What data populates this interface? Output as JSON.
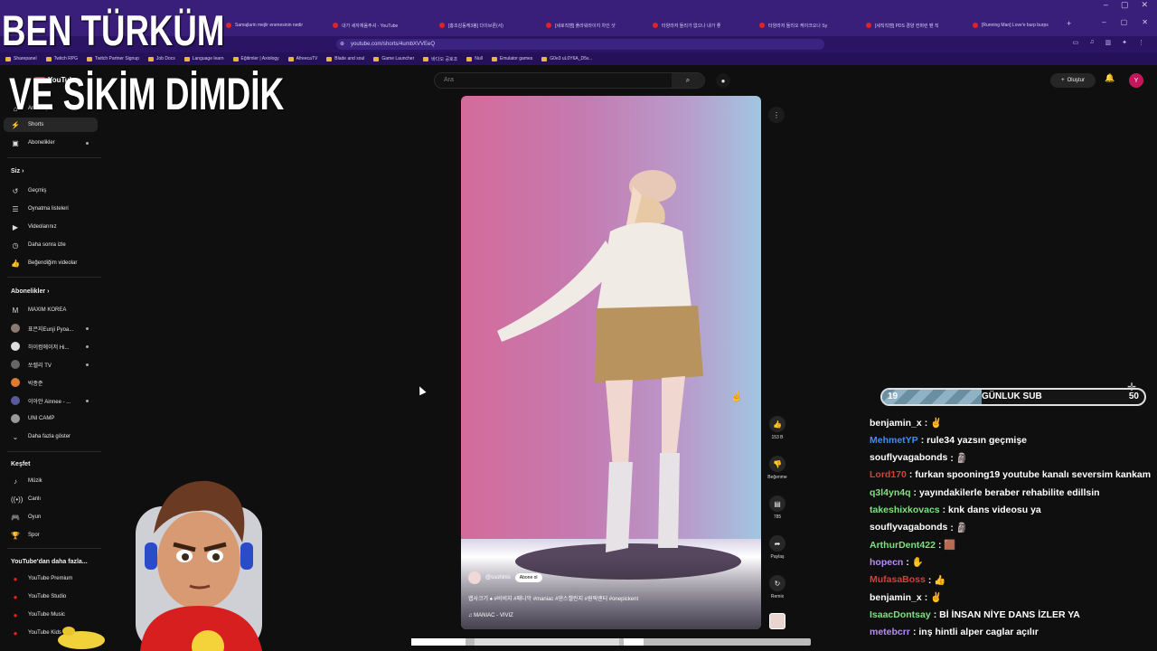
{
  "colors": {
    "browser_bg": "#3a1f7a",
    "accent_red": "#e02323",
    "bg": "#0f0f0f"
  },
  "browser": {
    "tabs": [
      "Samajlarin mejlir enenesinin nedir",
      "내가 세자재옴주셔 - YouTube",
      "[홍조감동케3봉] 다이브론(서)",
      "[세로직캠] 플라워라이지 차인 샷",
      "타양라저 돌리가 없으나 내가 좋",
      "타양라저 돌리오 케이크오나 Sy",
      "[세직직캠] PDS 경양 컨퍼런 팬 직",
      "[Running Man] Love'e burp burps"
    ],
    "url": "youtube.com/shorts/4umbXVVEeQ",
    "bookmarks": [
      "Sharepanel",
      "Twitch RPG",
      "Twitch Partner Signup",
      "Job Docs",
      "Language learn",
      "Eğitimler | Axiology",
      "AfreecaTV",
      "Blade and soul",
      "Game Launcher",
      "바다오 공호조",
      "Null",
      "Emulator games",
      "G0e3 uL0Y6A_D5v..."
    ]
  },
  "header": {
    "logo": "YouTube",
    "search_placeholder": "Ara",
    "create_label": "Oluştur",
    "avatar_letter": "Y"
  },
  "sidebar": {
    "home": "Ana Sayfa",
    "shorts": "Shorts",
    "subscriptions": "Abonelikler",
    "you_head": "Siz",
    "you_items": [
      "Geçmiş",
      "Oynatma listeleri",
      "Videolarınız",
      "Daha sonra izle",
      "Beğendiğim videolar"
    ],
    "subs_head": "Abonelikler",
    "channels": [
      "MAXIM KOREA",
      "표은지Eunji Pyoa...",
      "하이컴에이저 Hi...",
      "쏘렐리 TV",
      "박종준",
      "이아얀 Ainnee - ...",
      "UNI CAMP"
    ],
    "show_more": "Daha fazla göster",
    "explore_head": "Keşfet",
    "explore_items": [
      "Müzik",
      "Canlı",
      "Oyun",
      "Spor"
    ],
    "more_head": "YouTube'dan daha fazla...",
    "more_items": [
      "YouTube Premium",
      "YouTube Studio",
      "YouTube Music",
      "YouTube Kids"
    ]
  },
  "video": {
    "channel": "@ssohinis",
    "subscribe": "Abone ol",
    "caption": "랩사크기 ♠ #비비지 #매니악 #maniac #댄스챌린지 #원픽엔터 #onepickent",
    "music": "♫ MANIAC - VIVIZ",
    "like_count": "153 B",
    "dislike_label": "Beğenme",
    "comment_count": "785",
    "share_label": "Paylaş",
    "remix_label": "Remix"
  },
  "stream": {
    "title_line1": "BEN TÜRKÜM",
    "title_line2": "VE SİKİM DİMDİK",
    "sub_goal": {
      "current": "19",
      "label": "GÜNLUK SUB",
      "target": "50",
      "progress": 0.38
    }
  },
  "chat": [
    {
      "user": "benjamin_x",
      "text": " : ✌",
      "color": "#ffffff"
    },
    {
      "user": "MehmetYP",
      "text": " : rule34 yazsın geçmişe",
      "color": "#3d8cff"
    },
    {
      "user": "souflyvagabonds",
      "text": " : 🗿",
      "color": "#ffffff"
    },
    {
      "user": "Lord170",
      "text": " : furkan spooning19 youtube kanalı seversim kankam",
      "color": "#e03a3a"
    },
    {
      "user": "q3l4yn4q",
      "text": " : yayındakilerle beraber rehabilite edillsin",
      "color": "#7fe07f"
    },
    {
      "user": "takeshixkovacs",
      "text": " : knk dans videosu ya",
      "color": "#7fe07f"
    },
    {
      "user": "souflyvagabonds",
      "text": " : 🗿",
      "color": "#ffffff"
    },
    {
      "user": "ArthurDent422",
      "text": " : 🟫",
      "color": "#7fe07f"
    },
    {
      "user": "hopecn",
      "text": " : ✋",
      "color": "#b58cff"
    },
    {
      "user": "MufasaBoss",
      "text": " : 👍",
      "color": "#e03a3a"
    },
    {
      "user": "benjamin_x",
      "text": " : ✌",
      "color": "#ffffff"
    },
    {
      "user": "IsaacDontsay",
      "text": " : Bİ İNSAN NİYE DANS İZLER YA",
      "color": "#7fe07f"
    },
    {
      "user": "metebcrr",
      "text": " : inş hintli alper caglar açılır",
      "color": "#b58cff"
    }
  ]
}
